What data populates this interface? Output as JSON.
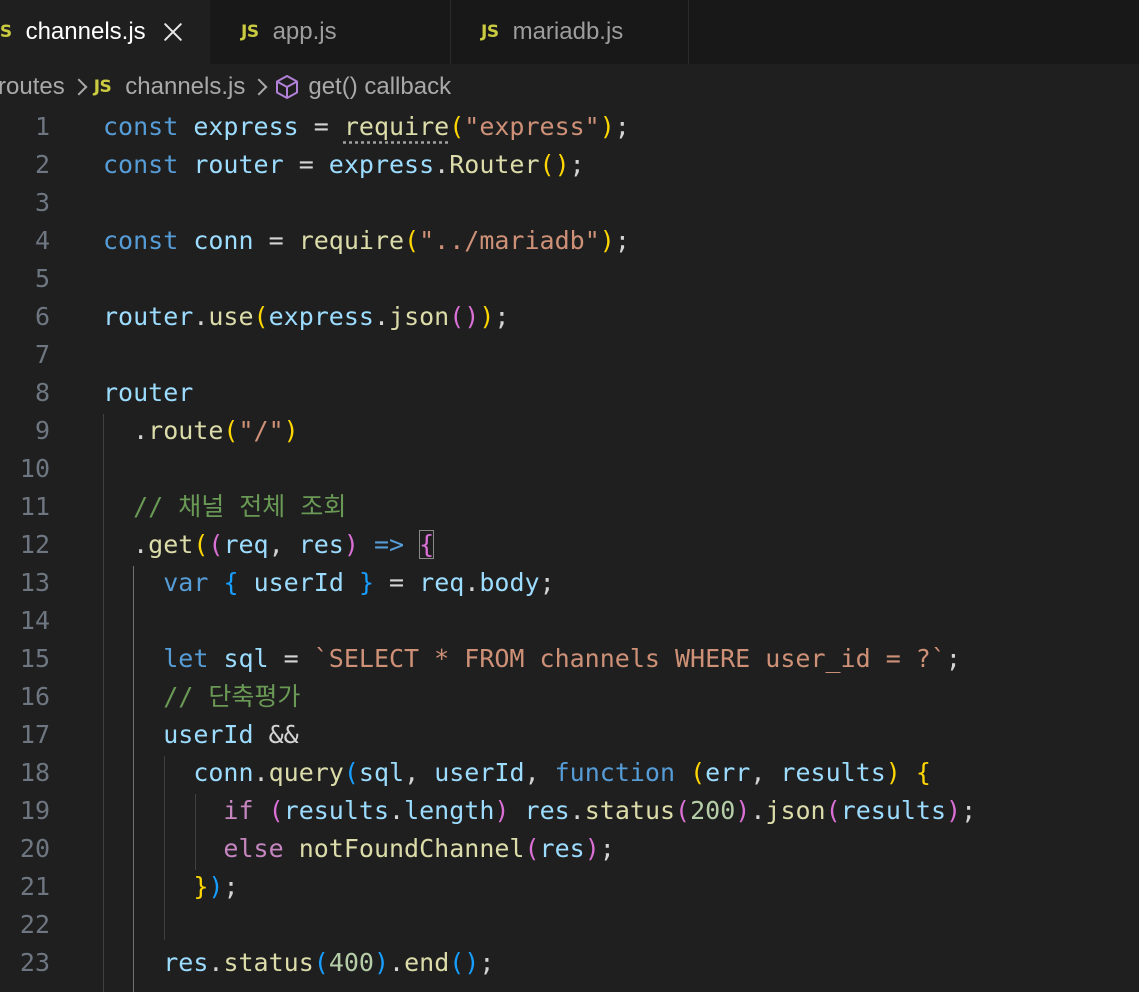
{
  "tabs": [
    {
      "icon": "JS",
      "label": "channels.js",
      "active": true
    },
    {
      "icon": "JS",
      "label": "app.js",
      "active": false
    },
    {
      "icon": "JS",
      "label": "mariadb.js",
      "active": false
    }
  ],
  "breadcrumb": {
    "folder": "routes",
    "file_icon": "JS",
    "file": "channels.js",
    "symbol": "get() callback"
  },
  "code_lines": [
    {
      "n": "1",
      "tokens": [
        [
          "kw",
          "const"
        ],
        [
          "plain",
          " "
        ],
        [
          "var",
          "express"
        ],
        [
          "plain",
          " = "
        ],
        [
          "fn dots",
          "require"
        ],
        [
          "b1",
          "("
        ],
        [
          "str",
          "\"express\""
        ],
        [
          "b1",
          ")"
        ],
        [
          "plain",
          ";"
        ]
      ]
    },
    {
      "n": "2",
      "tokens": [
        [
          "kw",
          "const"
        ],
        [
          "plain",
          " "
        ],
        [
          "var",
          "router"
        ],
        [
          "plain",
          " = "
        ],
        [
          "var",
          "express"
        ],
        [
          "plain",
          "."
        ],
        [
          "fn",
          "Router"
        ],
        [
          "b1",
          "()"
        ],
        [
          "plain",
          ";"
        ]
      ]
    },
    {
      "n": "3",
      "tokens": []
    },
    {
      "n": "4",
      "tokens": [
        [
          "kw",
          "const"
        ],
        [
          "plain",
          " "
        ],
        [
          "var",
          "conn"
        ],
        [
          "plain",
          " = "
        ],
        [
          "fn",
          "require"
        ],
        [
          "b1",
          "("
        ],
        [
          "str",
          "\"../mariadb\""
        ],
        [
          "b1",
          ")"
        ],
        [
          "plain",
          ";"
        ]
      ]
    },
    {
      "n": "5",
      "tokens": []
    },
    {
      "n": "6",
      "tokens": [
        [
          "var",
          "router"
        ],
        [
          "plain",
          "."
        ],
        [
          "fn",
          "use"
        ],
        [
          "b1",
          "("
        ],
        [
          "var",
          "express"
        ],
        [
          "plain",
          "."
        ],
        [
          "fn",
          "json"
        ],
        [
          "b2",
          "()"
        ],
        [
          "b1",
          ")"
        ],
        [
          "plain",
          ";"
        ]
      ]
    },
    {
      "n": "7",
      "tokens": []
    },
    {
      "n": "8",
      "tokens": [
        [
          "var",
          "router"
        ]
      ]
    },
    {
      "n": "9",
      "tokens": [
        [
          "plain",
          "  ."
        ],
        [
          "fn",
          "route"
        ],
        [
          "b1",
          "("
        ],
        [
          "str",
          "\"/\""
        ],
        [
          "b1",
          ")"
        ]
      ]
    },
    {
      "n": "10",
      "tokens": []
    },
    {
      "n": "11",
      "tokens": [
        [
          "cmt",
          "  // 채널 전체 조회"
        ]
      ]
    },
    {
      "n": "12",
      "tokens": [
        [
          "plain",
          "  ."
        ],
        [
          "fn",
          "get"
        ],
        [
          "b1",
          "("
        ],
        [
          "b2",
          "("
        ],
        [
          "var",
          "req"
        ],
        [
          "plain",
          ", "
        ],
        [
          "var",
          "res"
        ],
        [
          "b2",
          ")"
        ],
        [
          "plain",
          " "
        ],
        [
          "kw",
          "=>"
        ],
        [
          "plain",
          " "
        ],
        [
          "b2 match",
          "{"
        ]
      ]
    },
    {
      "n": "13",
      "tokens": [
        [
          "plain",
          "    "
        ],
        [
          "kw",
          "var"
        ],
        [
          "plain",
          " "
        ],
        [
          "b3",
          "{"
        ],
        [
          "plain",
          " "
        ],
        [
          "var",
          "userId"
        ],
        [
          "plain",
          " "
        ],
        [
          "b3",
          "}"
        ],
        [
          "plain",
          " = "
        ],
        [
          "var",
          "req"
        ],
        [
          "plain",
          "."
        ],
        [
          "var",
          "body"
        ],
        [
          "plain",
          ";"
        ]
      ]
    },
    {
      "n": "14",
      "tokens": []
    },
    {
      "n": "15",
      "tokens": [
        [
          "plain",
          "    "
        ],
        [
          "kw",
          "let"
        ],
        [
          "plain",
          " "
        ],
        [
          "var",
          "sql"
        ],
        [
          "plain",
          " = "
        ],
        [
          "str",
          "`SELECT * FROM channels WHERE user_id = ?`"
        ],
        [
          "plain",
          ";"
        ]
      ]
    },
    {
      "n": "16",
      "tokens": [
        [
          "cmt",
          "    // 단축평가"
        ]
      ]
    },
    {
      "n": "17",
      "tokens": [
        [
          "plain",
          "    "
        ],
        [
          "var",
          "userId"
        ],
        [
          "plain",
          " &&"
        ]
      ]
    },
    {
      "n": "18",
      "tokens": [
        [
          "plain",
          "      "
        ],
        [
          "var",
          "conn"
        ],
        [
          "plain",
          "."
        ],
        [
          "fn",
          "query"
        ],
        [
          "b3",
          "("
        ],
        [
          "var",
          "sql"
        ],
        [
          "plain",
          ", "
        ],
        [
          "var",
          "userId"
        ],
        [
          "plain",
          ", "
        ],
        [
          "kw",
          "function"
        ],
        [
          "plain",
          " "
        ],
        [
          "b1",
          "("
        ],
        [
          "var",
          "err"
        ],
        [
          "plain",
          ", "
        ],
        [
          "var",
          "results"
        ],
        [
          "b1",
          ")"
        ],
        [
          "plain",
          " "
        ],
        [
          "b1",
          "{"
        ]
      ]
    },
    {
      "n": "19",
      "tokens": [
        [
          "plain",
          "        "
        ],
        [
          "ctl",
          "if"
        ],
        [
          "plain",
          " "
        ],
        [
          "b2",
          "("
        ],
        [
          "var",
          "results"
        ],
        [
          "plain",
          "."
        ],
        [
          "var",
          "length"
        ],
        [
          "b2",
          ")"
        ],
        [
          "plain",
          " "
        ],
        [
          "var",
          "res"
        ],
        [
          "plain",
          "."
        ],
        [
          "fn",
          "status"
        ],
        [
          "b2",
          "("
        ],
        [
          "num",
          "200"
        ],
        [
          "b2",
          ")"
        ],
        [
          "plain",
          "."
        ],
        [
          "fn",
          "json"
        ],
        [
          "b2",
          "("
        ],
        [
          "var",
          "results"
        ],
        [
          "b2",
          ")"
        ],
        [
          "plain",
          ";"
        ]
      ]
    },
    {
      "n": "20",
      "tokens": [
        [
          "plain",
          "        "
        ],
        [
          "ctl",
          "else"
        ],
        [
          "plain",
          " "
        ],
        [
          "fn",
          "notFoundChannel"
        ],
        [
          "b2",
          "("
        ],
        [
          "var",
          "res"
        ],
        [
          "b2",
          ")"
        ],
        [
          "plain",
          ";"
        ]
      ]
    },
    {
      "n": "21",
      "tokens": [
        [
          "plain",
          "      "
        ],
        [
          "b1",
          "}"
        ],
        [
          "b3",
          ")"
        ],
        [
          "plain",
          ";"
        ]
      ]
    },
    {
      "n": "22",
      "tokens": []
    },
    {
      "n": "23",
      "tokens": [
        [
          "plain",
          "    "
        ],
        [
          "var",
          "res"
        ],
        [
          "plain",
          "."
        ],
        [
          "fn",
          "status"
        ],
        [
          "b3",
          "("
        ],
        [
          "num",
          "400"
        ],
        [
          "b3",
          ")"
        ],
        [
          "plain",
          "."
        ],
        [
          "fn",
          "end"
        ],
        [
          "b3",
          "()"
        ],
        [
          "plain",
          ";"
        ]
      ]
    }
  ]
}
